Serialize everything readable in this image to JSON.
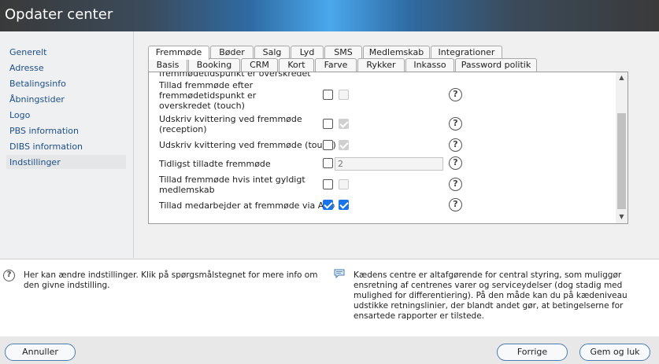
{
  "window": {
    "title": "Opdater center"
  },
  "sidebar": {
    "items": [
      {
        "label": "Generelt"
      },
      {
        "label": "Adresse"
      },
      {
        "label": "Betalingsinfo"
      },
      {
        "label": "Åbningstider"
      },
      {
        "label": "Logo"
      },
      {
        "label": "PBS information"
      },
      {
        "label": "DIBS information"
      },
      {
        "label": "Indstillinger"
      }
    ],
    "selected": "Indstillinger"
  },
  "tabs": {
    "row1": [
      "Fremmøde",
      "Bøder",
      "Salg",
      "Lyd",
      "SMS",
      "Medlemskab",
      "Integrationer"
    ],
    "row2": [
      "Basis",
      "Booking",
      "CRM",
      "Kort",
      "Farve",
      "Rykker",
      "Inkasso",
      "Password politik"
    ],
    "active": "Fremmøde"
  },
  "settings": {
    "cutoff_label": "fremmødetidspunkt er overskredet",
    "rows": [
      {
        "label": "Tillad fremmøde efter fremmødetidspunkt er overskredet (touch)",
        "checked": false,
        "secondary_checked": false
      },
      {
        "label": "Udskriv kvittering ved fremmøde (reception)",
        "checked": false,
        "secondary_checked": true
      },
      {
        "label": "Udskriv kvittering ved fremmøde (touch)",
        "checked": false,
        "secondary_checked": true
      },
      {
        "label": "Tidligst tilladte fremmøde",
        "checked": false,
        "value": "2"
      },
      {
        "label": "Tillad fremmøde hvis intet gyldigt medlemskab",
        "checked": false,
        "secondary_checked": false
      },
      {
        "label": "Tillad medarbejder at fremmøde via App",
        "checked": true,
        "secondary_checked": true
      }
    ],
    "help_glyph": "?"
  },
  "info": {
    "help_text": "Her kan ændre indstillinger. Klik på spørgsmålstegnet for mere info om den givne indstilling.",
    "chain_text": "Kædens centre er altafgørende for central styring, som muliggør ensretning af centrenes varer og serviceydelser (dog stadig med mulighed for differentiering). På den måde kan du på kædeniveau udstikke retningslinier, der blandt andet gør, at betingelserne for ensartede rapporter er tilstede.",
    "help_glyph": "?"
  },
  "footer": {
    "cancel": "Annuller",
    "previous": "Forrige",
    "save_close": "Gem og luk"
  },
  "colors": {
    "accent": "#1a73e8",
    "link": "#1e4f86",
    "button_border": "#4a7cb0"
  }
}
